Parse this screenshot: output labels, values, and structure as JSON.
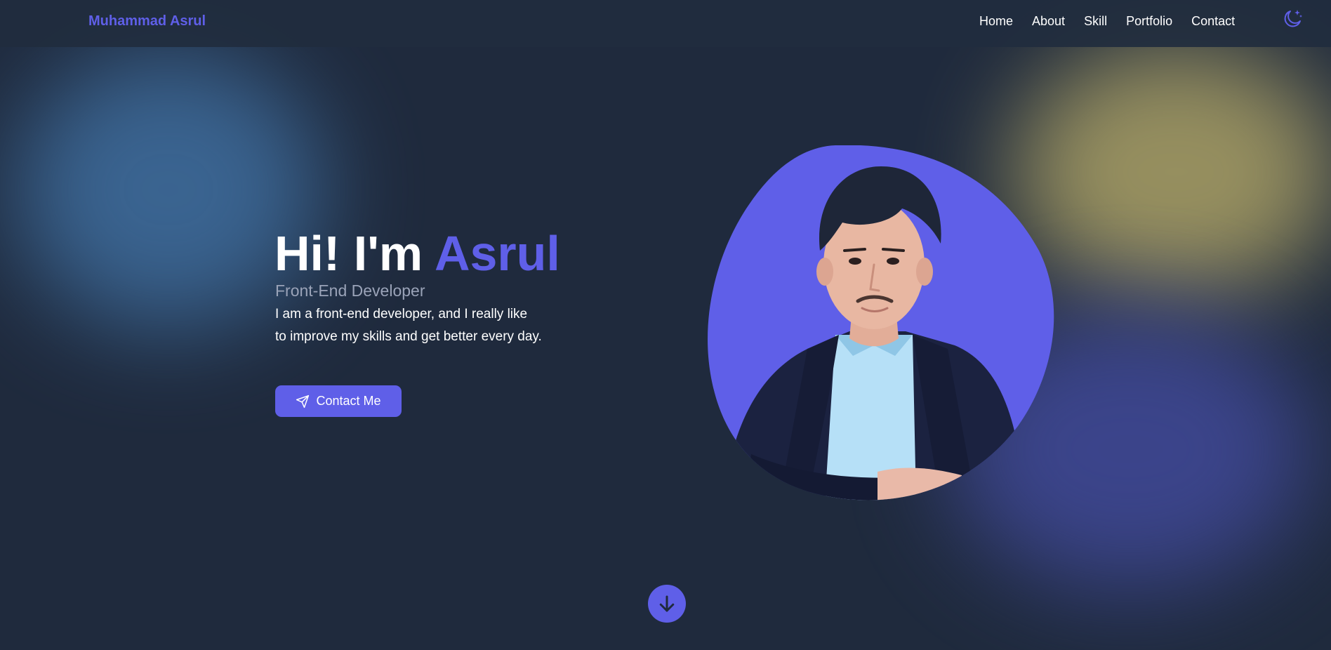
{
  "brand": {
    "name": "Muhammad Asrul",
    "color": "#5f5fe8"
  },
  "nav": {
    "links": [
      {
        "label": "Home"
      },
      {
        "label": "About"
      },
      {
        "label": "Skill"
      },
      {
        "label": "Portfolio"
      },
      {
        "label": "Contact"
      }
    ],
    "theme_toggle_icon": "moon-stars-icon"
  },
  "hero": {
    "greeting": "Hi! I'm",
    "name": "Asrul",
    "role": "Front-End Developer",
    "description": "I am a front-end developer, and I really like to improve my skills and get better every day.",
    "cta": {
      "label": "Contact Me",
      "icon": "send-icon"
    },
    "portrait_icon": "profile-photo"
  },
  "scroll": {
    "icon": "arrow-down-icon"
  },
  "colors": {
    "background": "#1f2a3d",
    "accent": "#5f5fe8",
    "muted_text": "#9aa3b8",
    "text": "#ffffff"
  }
}
